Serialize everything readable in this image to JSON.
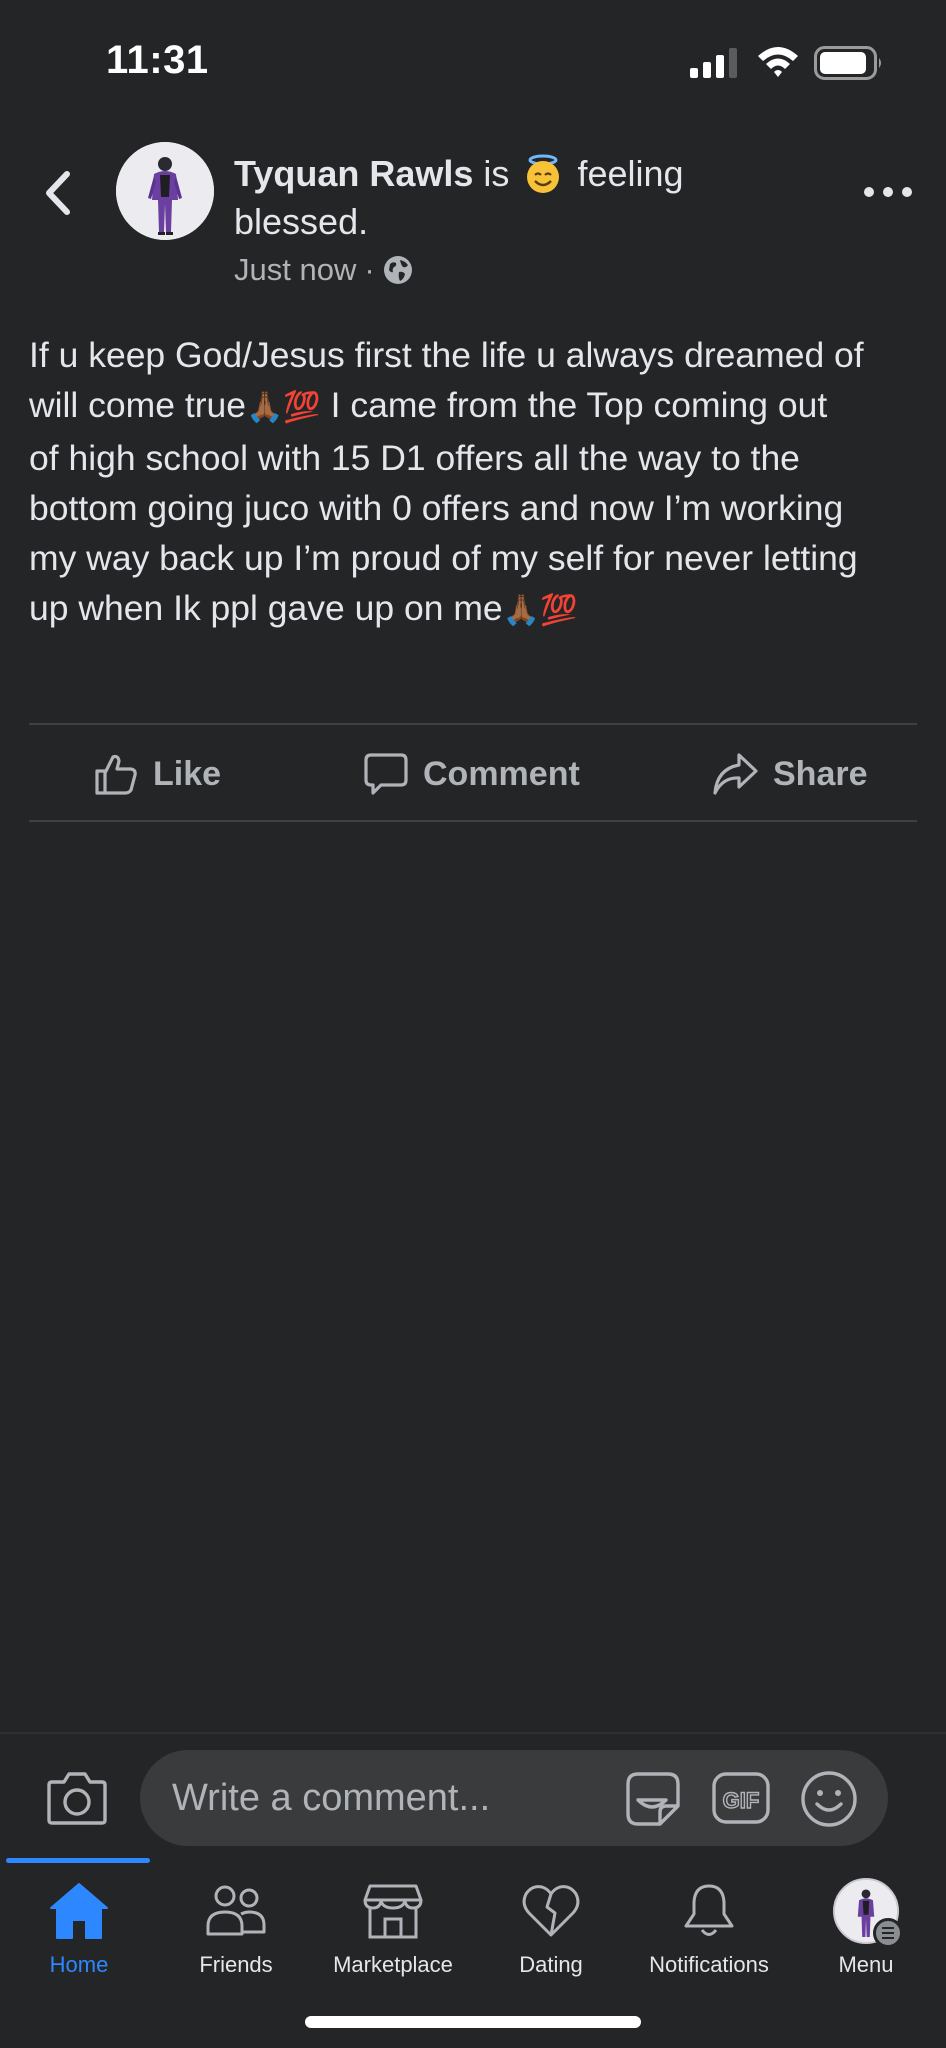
{
  "status_bar": {
    "time": "11:31"
  },
  "post": {
    "author": "Tyquan Rawls",
    "is_word": "is",
    "feeling_text": "feeling",
    "feeling_line2": "blessed.",
    "timestamp": "Just now",
    "separator": "·",
    "body_lines": [
      "If u keep God/Jesus first the life u always dreamed of",
      "will come true",
      " I came from the Top coming out",
      "of high school with 15 D1 offers all the way to the",
      "bottom going juco with 0 offers and now I’m working",
      "my way back up I’m proud of my self for never letting",
      "up when Ik ppl gave up on me"
    ],
    "emoji_pray": "🙏🏾",
    "emoji_hundred": "💯"
  },
  "actions": {
    "like": "Like",
    "comment": "Comment",
    "share": "Share"
  },
  "comment_bar": {
    "placeholder": "Write a comment..."
  },
  "tabs": [
    {
      "label": "Home",
      "active": true
    },
    {
      "label": "Friends"
    },
    {
      "label": "Marketplace"
    },
    {
      "label": "Dating"
    },
    {
      "label": "Notifications"
    },
    {
      "label": "Menu"
    }
  ],
  "colors": {
    "background": "#242526",
    "accent": "#2d88ff",
    "text": "#e4e6eb",
    "secondary_text": "#b0b3b8"
  }
}
